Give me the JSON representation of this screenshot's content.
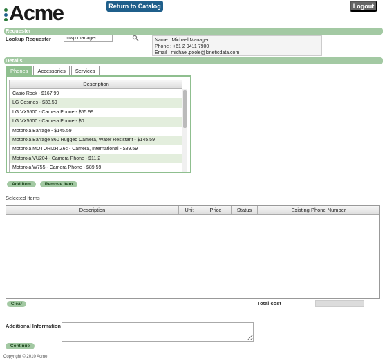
{
  "header": {
    "logo_text": "Acme",
    "logo_dot_colors": [
      "#2a7a3a",
      "#1e5f8a",
      "#2a7a3a"
    ],
    "return_label": "Return to Catalog",
    "logout_label": "Logout"
  },
  "requester": {
    "section_title": "Requester",
    "lookup_label": "Lookup Requester",
    "lookup_value": "mwp manager",
    "info": {
      "name": "Name : Michael Manager",
      "phone": "Phone : +61 2 9411 7900",
      "email": "Email : michael.poole@kineticdata.com"
    }
  },
  "details": {
    "section_title": "Details",
    "tabs": [
      "Phones",
      "Accessories",
      "Services"
    ],
    "active_tab": "Phones",
    "list_header": "Description",
    "items": [
      "Casio Rock - $167.99",
      "LG Cosmos - $33.59",
      "LG VX5500 - Camera Phone - $55.99",
      "LG VX5600 - Camera Phone - $0",
      "Motorola Barrage - $145.59",
      "Motorola Barrage 860 Rugged Camera, Water Resistant - $145.59",
      "Motorola MOTORIZR Z6c - Camera, International - $89.59",
      "Motorola VU204 - Camera Phone - $11.2",
      "Motorola W755 - Camera Phone - $89.59"
    ],
    "add_label": "Add Item",
    "remove_label": "Remove Item"
  },
  "selected": {
    "title": "Selected Items",
    "columns": [
      "Description",
      "Unit",
      "Price",
      "Status",
      "Existing Phone Number"
    ],
    "clear_label": "Clear",
    "total_label": "Total cost"
  },
  "additional": {
    "label": "Additional Information",
    "continue_label": "Continue"
  },
  "footer": {
    "copyright": "Copyright © 2010 Acme"
  },
  "colors": {
    "section_bar": "#a3c9a3",
    "catalog_button": "#1f5f8b",
    "logout_button": "#666666",
    "row_highlight": "#e3eedd"
  }
}
